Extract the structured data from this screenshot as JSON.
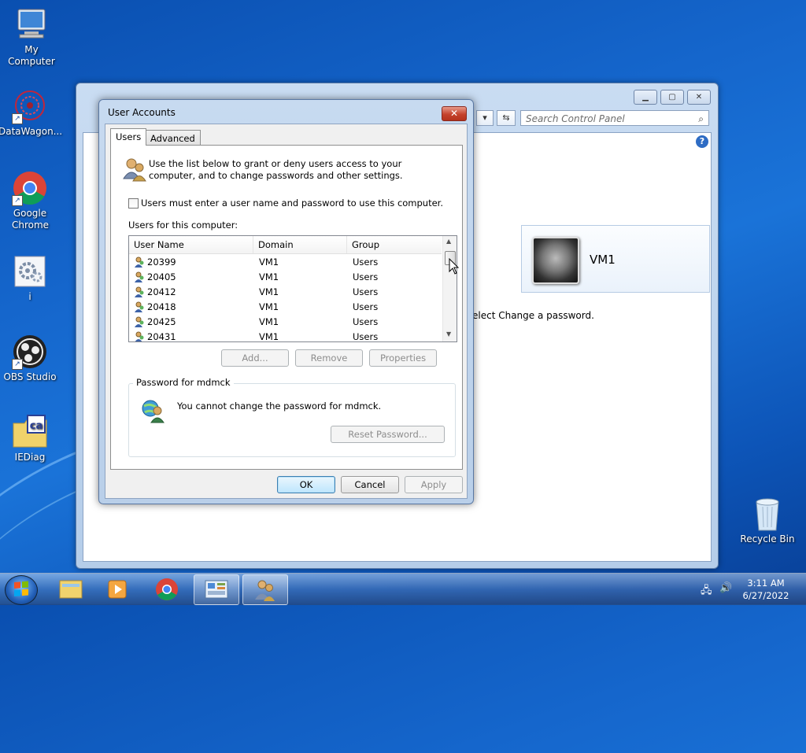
{
  "desktop": {
    "icons": [
      {
        "label": "My Computer"
      },
      {
        "label": "DataWagon..."
      },
      {
        "label": "Google Chrome"
      },
      {
        "label": "i"
      },
      {
        "label": "OBS Studio"
      },
      {
        "label": "IEDiag"
      },
      {
        "label": "Recycle Bin"
      }
    ]
  },
  "control_panel": {
    "search_placeholder": "Search Control Panel",
    "account_name": "VM1",
    "partial_text": "elect Change a password.",
    "help_glyph": "?"
  },
  "dialog": {
    "title": "User Accounts",
    "close_glyph": "✕",
    "tabs": [
      {
        "label": "Users"
      },
      {
        "label": "Advanced"
      }
    ],
    "intro": "Use the list below to grant or deny users access to your computer, and to change passwords and other settings.",
    "checkbox_label": "Users must enter a user name and password to use this computer.",
    "list_label": "Users for this computer:",
    "columns": [
      "User Name",
      "Domain",
      "Group"
    ],
    "rows": [
      {
        "name": "20399",
        "domain": "VM1",
        "group": "Users"
      },
      {
        "name": "20405",
        "domain": "VM1",
        "group": "Users"
      },
      {
        "name": "20412",
        "domain": "VM1",
        "group": "Users"
      },
      {
        "name": "20418",
        "domain": "VM1",
        "group": "Users"
      },
      {
        "name": "20425",
        "domain": "VM1",
        "group": "Users"
      },
      {
        "name": "20431",
        "domain": "VM1",
        "group": "Users"
      }
    ],
    "buttons": {
      "add": "Add...",
      "remove": "Remove",
      "properties": "Properties"
    },
    "password_group": {
      "title": "Password for mdmck",
      "message": "You cannot change the password for mdmck.",
      "reset": "Reset Password..."
    },
    "footer": {
      "ok": "OK",
      "cancel": "Cancel",
      "apply": "Apply"
    }
  },
  "taskbar": {
    "time": "3:11 AM",
    "date": "6/27/2022"
  }
}
